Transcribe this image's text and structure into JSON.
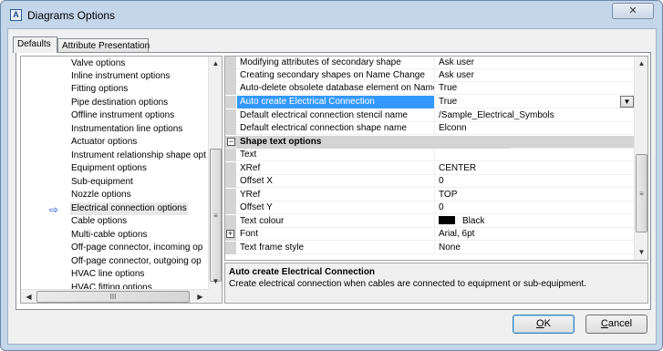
{
  "window": {
    "title": "Diagrams Options",
    "app_icon_letter": "A",
    "close_glyph": "✕"
  },
  "tabs": [
    {
      "label": "Defaults",
      "active": true
    },
    {
      "label": "Attribute Presentation",
      "active": false
    }
  ],
  "tree": {
    "items": [
      {
        "label": "Valve options"
      },
      {
        "label": "Inline instrument options"
      },
      {
        "label": "Fitting options"
      },
      {
        "label": "Pipe destination options"
      },
      {
        "label": "Offline instrument options"
      },
      {
        "label": "Instrumentation line options"
      },
      {
        "label": "Actuator options"
      },
      {
        "label": "Instrument relationship shape opt"
      },
      {
        "label": "Equipment options"
      },
      {
        "label": "Sub-equipment"
      },
      {
        "label": "Nozzle options"
      },
      {
        "label": "Electrical connection options",
        "selected": true
      },
      {
        "label": "Cable options"
      },
      {
        "label": "Multi-cable options"
      },
      {
        "label": "Off-page connector, incoming op"
      },
      {
        "label": "Off-page connector, outgoing op"
      },
      {
        "label": "HVAC line options"
      },
      {
        "label": "HVAC fitting options"
      }
    ],
    "selected_marker_icon": "arrow-right-icon",
    "hscroll_thumb_glyph": "III"
  },
  "properties": {
    "rows": [
      {
        "name": "Modifying attributes of secondary shape",
        "value": "Ask user"
      },
      {
        "name": "Creating secondary shapes on Name Change",
        "value": "Ask user"
      },
      {
        "name": "Auto-delete obsolete database element on Name",
        "value": "True"
      },
      {
        "name": "Auto create Electrical Connection",
        "value": "True"
      },
      {
        "name": "Default electrical connection stencil name",
        "value": "/Sample_Electrical_Symbols"
      },
      {
        "name": "Default electrical connection shape name",
        "value": "Elconn"
      },
      {
        "name": "Shape text options",
        "value": ""
      },
      {
        "name": "Text",
        "value": ""
      },
      {
        "name": "XRef",
        "value": "CENTER"
      },
      {
        "name": "Offset X",
        "value": "0"
      },
      {
        "name": "YRef",
        "value": "TOP"
      },
      {
        "name": "Offset Y",
        "value": "0"
      },
      {
        "name": "Text colour",
        "value": "Black"
      },
      {
        "name": "Font",
        "value": "Arial, 6pt"
      },
      {
        "name": "Text frame style",
        "value": "None"
      }
    ],
    "category_expander": "−",
    "font_expander": "+",
    "text_colour_swatch": "#000000"
  },
  "description": {
    "title": "Auto create Electrical Connection",
    "text": "Create electrical connection when cables are connected to equipment or sub-equipment."
  },
  "buttons": {
    "ok_mnemonic": "O",
    "ok_rest": "K",
    "cancel_mnemonic": "C",
    "cancel_rest": "ancel"
  },
  "colors": {
    "selection": "#3399ff",
    "marker": "#1f4ed8"
  }
}
